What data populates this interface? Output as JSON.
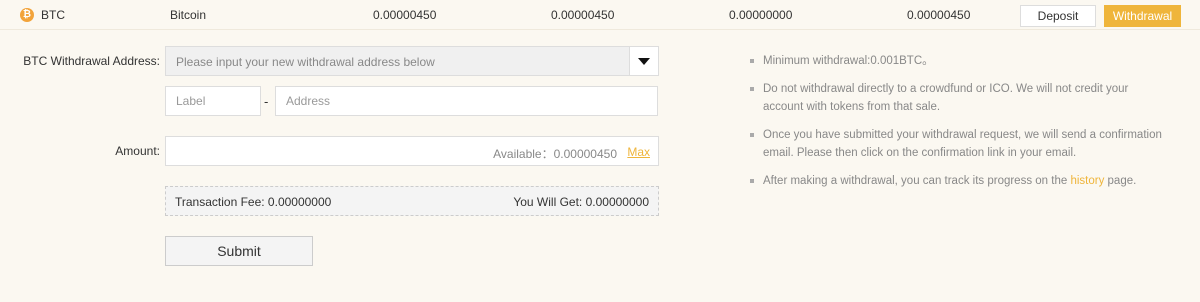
{
  "coin_row": {
    "icon": "bitcoin-icon",
    "icon_glyph": "₿",
    "symbol": "BTC",
    "name": "Bitcoin",
    "total": "0.00000450",
    "available": "0.00000450",
    "frozen": "0.00000000",
    "value": "0.00000450",
    "deposit_label": "Deposit",
    "withdrawal_label": "Withdrawal"
  },
  "form": {
    "address_label": "BTC Withdrawal Address:",
    "address_select_placeholder": "Please input your new withdrawal address below",
    "label_placeholder": "Label",
    "separator": "-",
    "address_placeholder": "Address",
    "amount_label": "Amount:",
    "available_text": "Available：0.00000450",
    "max_label": "Max",
    "fee_text": "Transaction Fee: 0.00000000",
    "you_get_text": "You Will Get: 0.00000000",
    "submit_label": "Submit"
  },
  "notes": {
    "item1": "Minimum withdrawal:0.001BTC。",
    "item2": "Do not withdrawal directly to a crowdfund or ICO. We will not credit your account with tokens from that sale.",
    "item3": "Once you have submitted your withdrawal request, we will send a confirmation email. Please then click on the confirmation link in your email.",
    "item4_before": "After making a withdrawal, you can track its progress on the ",
    "item4_link": "history",
    "item4_after": " page."
  },
  "colors": {
    "accent": "#efb53b",
    "background": "#fbf8f1"
  }
}
